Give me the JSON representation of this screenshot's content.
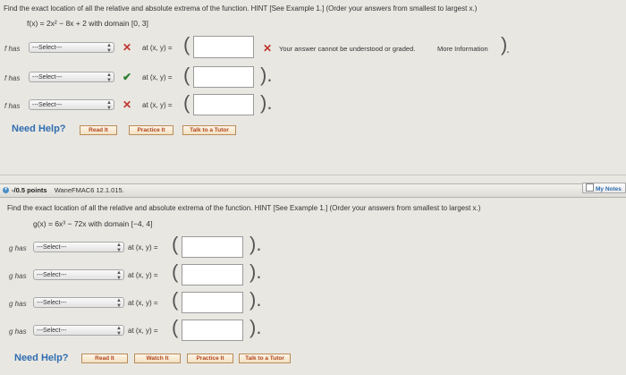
{
  "q1": {
    "prompt": "Find the exact location of all the relative and absolute extrema of the function. HINT [See Example 1.] (Order your answers from smallest to largest x.)",
    "function": "f(x) = 2x² − 8x + 2 with domain [0, 3]",
    "rows": [
      {
        "label": "f has",
        "select": "---Select---",
        "at": "at (x, y) =",
        "status": "wrong"
      },
      {
        "label": "f has",
        "select": "---Select---",
        "at": "at (x, y) =",
        "status": "correct"
      },
      {
        "label": "f has",
        "select": "---Select---",
        "at": "at (x, y) =",
        "status": "wrong"
      }
    ],
    "error_message": "Your answer cannot be understood or graded.",
    "more_info": "More Information"
  },
  "help1": {
    "title": "Need Help?",
    "buttons": [
      "Read It",
      "Practice It",
      "Talk to a Tutor"
    ]
  },
  "q2": {
    "points": "-/0.5 points",
    "source": "WaneFMAC6 12.1.015.",
    "notes": "My Notes",
    "prompt": "Find the exact location of all the relative and absolute extrema of the function. HINT [See Example 1.] (Order your answers from smallest to largest x.)",
    "function": "g(x) = 6x³ − 72x with domain [−4, 4]",
    "rows": [
      {
        "label": "g has",
        "select": "---Select---",
        "at": "at (x, y) ="
      },
      {
        "label": "g has",
        "select": "---Select---",
        "at": "at (x, y) ="
      },
      {
        "label": "g has",
        "select": "---Select---",
        "at": "at (x, y) ="
      },
      {
        "label": "g has",
        "select": "---Select---",
        "at": "at (x, y) ="
      }
    ]
  },
  "help2": {
    "title": "Need Help?",
    "buttons": [
      "Read It",
      "Watch It",
      "Practice It",
      "Talk to a Tutor"
    ]
  },
  "colors": {
    "link_blue": "#2f6db0",
    "error_red": "#c0342c",
    "ok_green": "#2e7d32"
  }
}
